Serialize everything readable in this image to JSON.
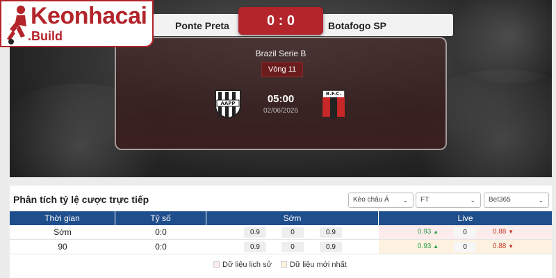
{
  "brand": {
    "name": "Keonhacai",
    "sub": ".Build",
    "color": "#b3242b"
  },
  "match": {
    "home": "Ponte Preta",
    "away": "Botafogo SP",
    "score": "0 : 0",
    "league": "Brazil Serie B",
    "round": "Vòng 11",
    "time": "05:00",
    "date": "02/06/2026",
    "home_crest_icon": "ponte-preta-crest-icon",
    "away_crest_icon": "botafogo-crest-icon",
    "away_crest_text": "B.F.C."
  },
  "odds_panel": {
    "title": "Phân tích tỷ lệ cược trực tiếp",
    "filters": [
      {
        "value": "Kèo châu Á"
      },
      {
        "value": "FT"
      },
      {
        "value": "Bet365"
      }
    ],
    "columns": [
      "Thời gian",
      "Tỷ số",
      "Sớm",
      "Live"
    ],
    "rows": [
      {
        "time": "Sớm",
        "score": "0:0",
        "early": [
          "0.9",
          "0",
          "0.9"
        ],
        "live": [
          "0.93",
          "0",
          "0.88"
        ]
      },
      {
        "time": "90",
        "score": "0:0",
        "early": [
          "0.9",
          "0",
          "0.9"
        ],
        "live": [
          "0.93",
          "0",
          "0.88"
        ]
      }
    ],
    "legend": [
      {
        "label": "Dữ liệu lịch sử",
        "color": "#fdecec"
      },
      {
        "label": "Dữ liệu mới nhất",
        "color": "#fdf2e0"
      }
    ],
    "header_color": "#1f4e8c"
  }
}
